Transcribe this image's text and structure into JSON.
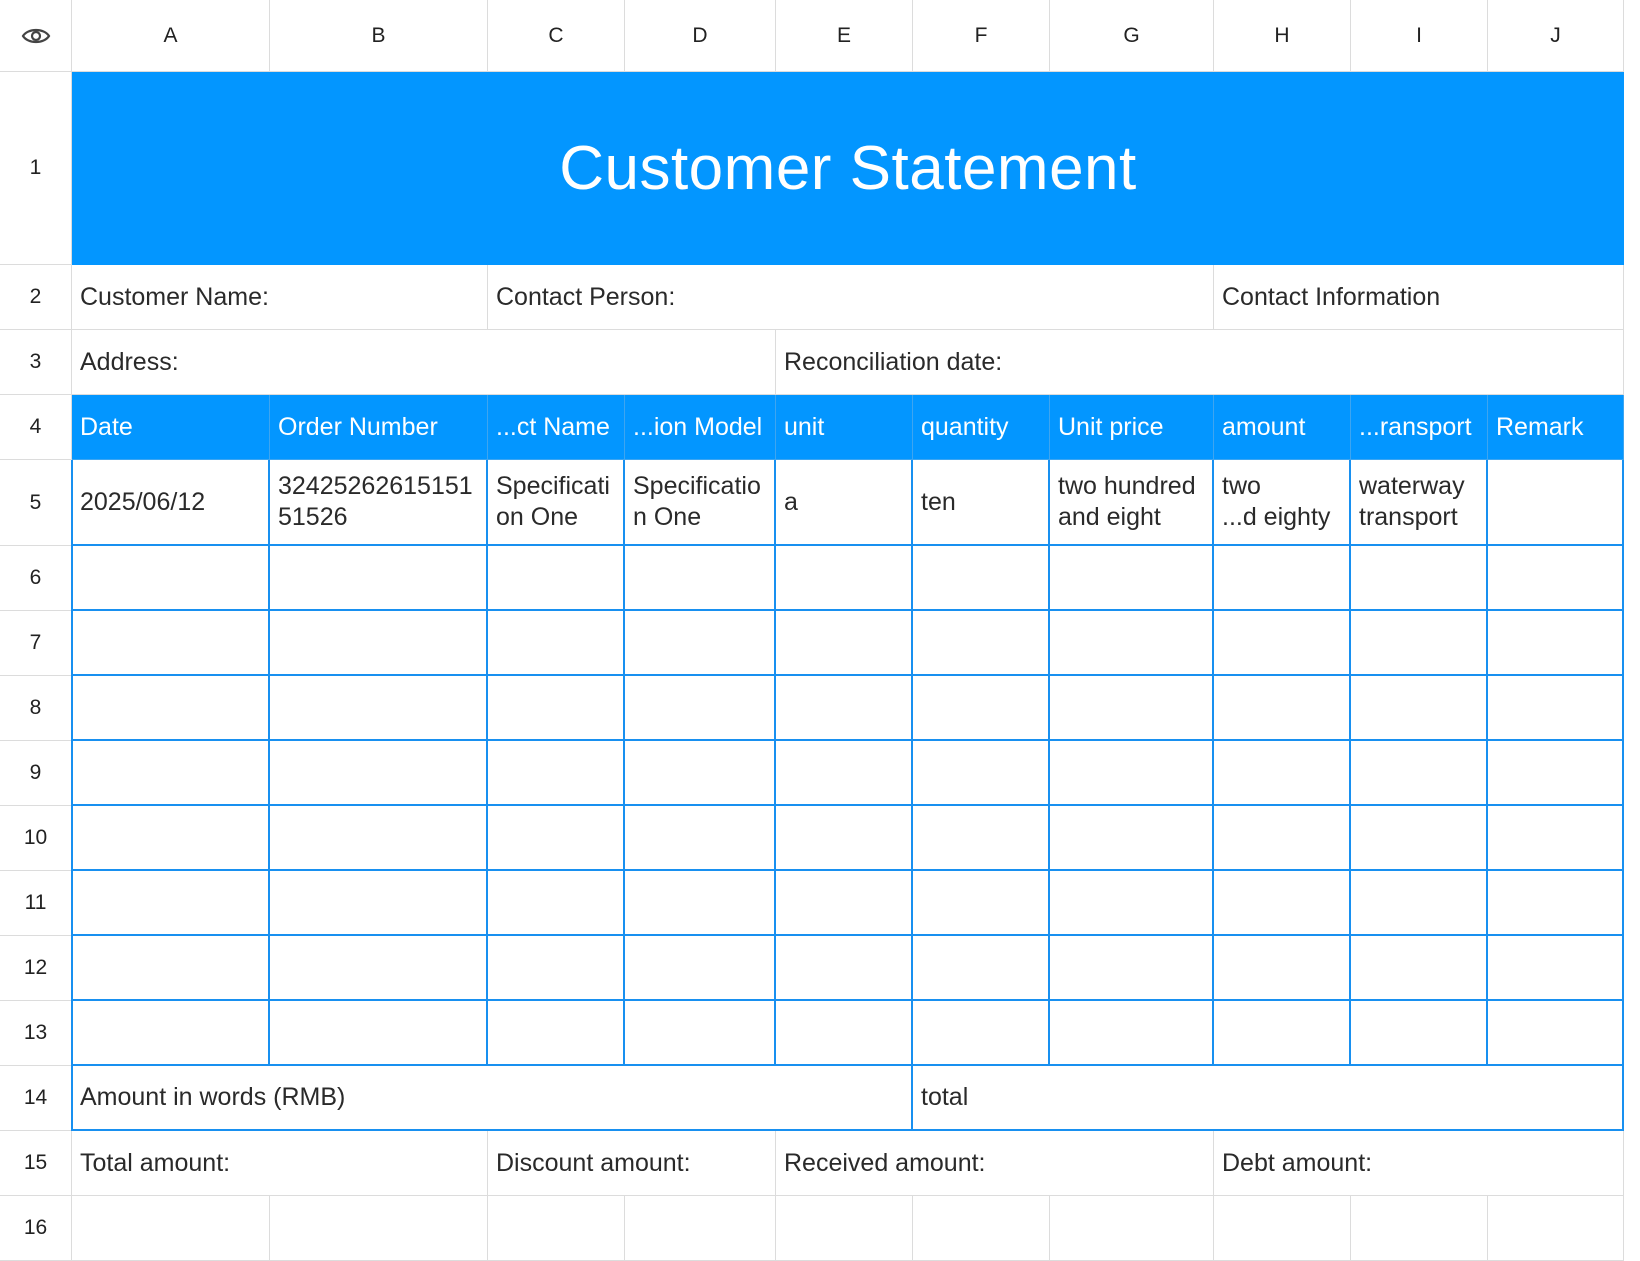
{
  "columns": [
    "A",
    "B",
    "C",
    "D",
    "E",
    "F",
    "G",
    "H",
    "I",
    "J"
  ],
  "rows": [
    "1",
    "2",
    "3",
    "4",
    "5",
    "6",
    "7",
    "8",
    "9",
    "10",
    "11",
    "12",
    "13",
    "14",
    "15",
    "16"
  ],
  "colors": {
    "accent": "#0396ff",
    "grid": "#dcdcdc",
    "table_border": "#1890f0"
  },
  "corner_icon": "eye-icon",
  "title": "Customer Statement",
  "info": {
    "customer_name": "Customer Name:",
    "contact_person": "Contact Person:",
    "contact_information": "Contact Information",
    "address": "Address:",
    "reconciliation_date": "Reconciliation date:"
  },
  "table": {
    "headers": [
      "Date",
      "Order Number",
      "...ct Name",
      "...ion Model",
      "unit",
      "quantity",
      "Unit price",
      "amount",
      "...ransport",
      "Remark"
    ],
    "rows": [
      [
        "2025/06/12",
        "3242526261515151526",
        "Specification One",
        "Specification One",
        "a",
        "ten",
        "two hundred and eight",
        "two ...d eighty",
        "waterway transport",
        ""
      ]
    ]
  },
  "row5_display": [
    "2025/06/12",
    "32425262615151\n51526",
    "Specificati\non One",
    "Specificatio\nn One",
    "a",
    "ten",
    "two hundred\nand eight",
    "two\n...d eighty",
    "waterway\ntransport",
    ""
  ],
  "totals": {
    "amount_in_words": "Amount in words (RMB)",
    "total": "total",
    "total_amount": "Total amount:",
    "discount_amount": "Discount amount:",
    "received_amount": "Received amount:",
    "debt_amount": "Debt amount:"
  }
}
